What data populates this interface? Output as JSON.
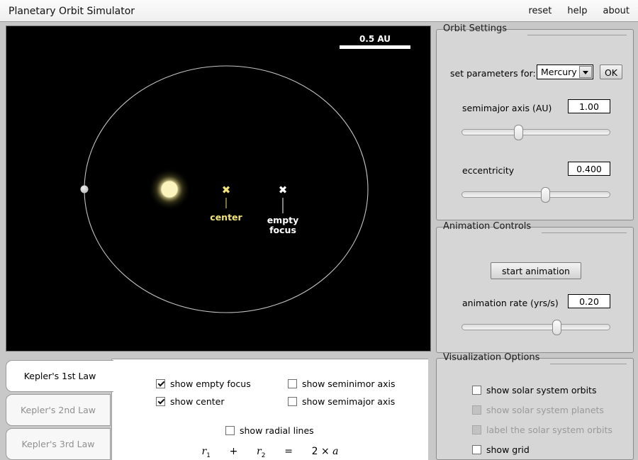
{
  "titlebar": {
    "app_title": "Planetary Orbit Simulator",
    "menu": [
      {
        "label": "reset",
        "name": "reset-menu-item"
      },
      {
        "label": "help",
        "name": "help-menu-item"
      },
      {
        "label": "about",
        "name": "about-menu-item"
      }
    ]
  },
  "canvas": {
    "scale_bar_label": "0.5 AU",
    "background_color": "#000000",
    "orbit_color": "#c8c8c8",
    "sun_color": "#fbf4c0",
    "planet_color": "#c9c9c9",
    "center_marker": {
      "glyph": "✖",
      "label": "center",
      "color": "#f2e27a"
    },
    "empty_focus_marker": {
      "glyph": "✖",
      "label_line1": "empty",
      "label_line2": "focus",
      "color": "#ffffff"
    }
  },
  "orbit_settings": {
    "title": "Orbit Settings",
    "set_parameters_label": "set parameters for:",
    "planet_selected": "Mercury",
    "ok_label": "OK",
    "semimajor_label": "semimajor axis (AU)",
    "semimajor_value": "1.00",
    "semimajor_slider_percent": 38,
    "eccentricity_label": "eccentricity",
    "eccentricity_value": "0.400",
    "eccentricity_slider_percent": 56
  },
  "animation_controls": {
    "title": "Animation Controls",
    "start_label": "start animation",
    "rate_label": "animation rate (yrs/s)",
    "rate_value": "0.20",
    "rate_slider_percent": 64
  },
  "visualization_options": {
    "title": "Visualization Options",
    "items": [
      {
        "label": "show solar system orbits",
        "checked": false,
        "disabled": false,
        "name": "checkbox-show-solar-system-orbits"
      },
      {
        "label": "show solar system planets",
        "checked": false,
        "disabled": true,
        "name": "checkbox-show-solar-system-planets"
      },
      {
        "label": "label the solar system orbits",
        "checked": false,
        "disabled": true,
        "name": "checkbox-label-solar-system-orbits"
      },
      {
        "label": "show grid",
        "checked": false,
        "disabled": false,
        "name": "checkbox-show-grid"
      }
    ]
  },
  "kepler_tabs": [
    {
      "label": "Kepler's 1st Law",
      "active": true,
      "name": "tab-keplers-1st-law"
    },
    {
      "label": "Kepler's 2nd Law",
      "active": false,
      "name": "tab-keplers-2nd-law"
    },
    {
      "label": "Kepler's 3rd Law",
      "active": false,
      "name": "tab-keplers-3rd-law"
    }
  ],
  "first_law_options": [
    {
      "label": "show empty focus",
      "checked": true,
      "name": "checkbox-show-empty-focus"
    },
    {
      "label": "show center",
      "checked": true,
      "name": "checkbox-show-center"
    },
    {
      "label": "show seminimor axis",
      "checked": false,
      "name": "checkbox-show-seminimor-axis"
    },
    {
      "label": "show semimajor axis",
      "checked": false,
      "name": "checkbox-show-semimajor-axis"
    },
    {
      "label": "show radial lines",
      "checked": false,
      "name": "checkbox-show-radial-lines"
    }
  ],
  "formula": {
    "r1": "r",
    "r1_sub": "1",
    "plus": "+",
    "r2": "r",
    "r2_sub": "2",
    "equals": "=",
    "rhs_num": "2 × ",
    "rhs_var": "a"
  }
}
